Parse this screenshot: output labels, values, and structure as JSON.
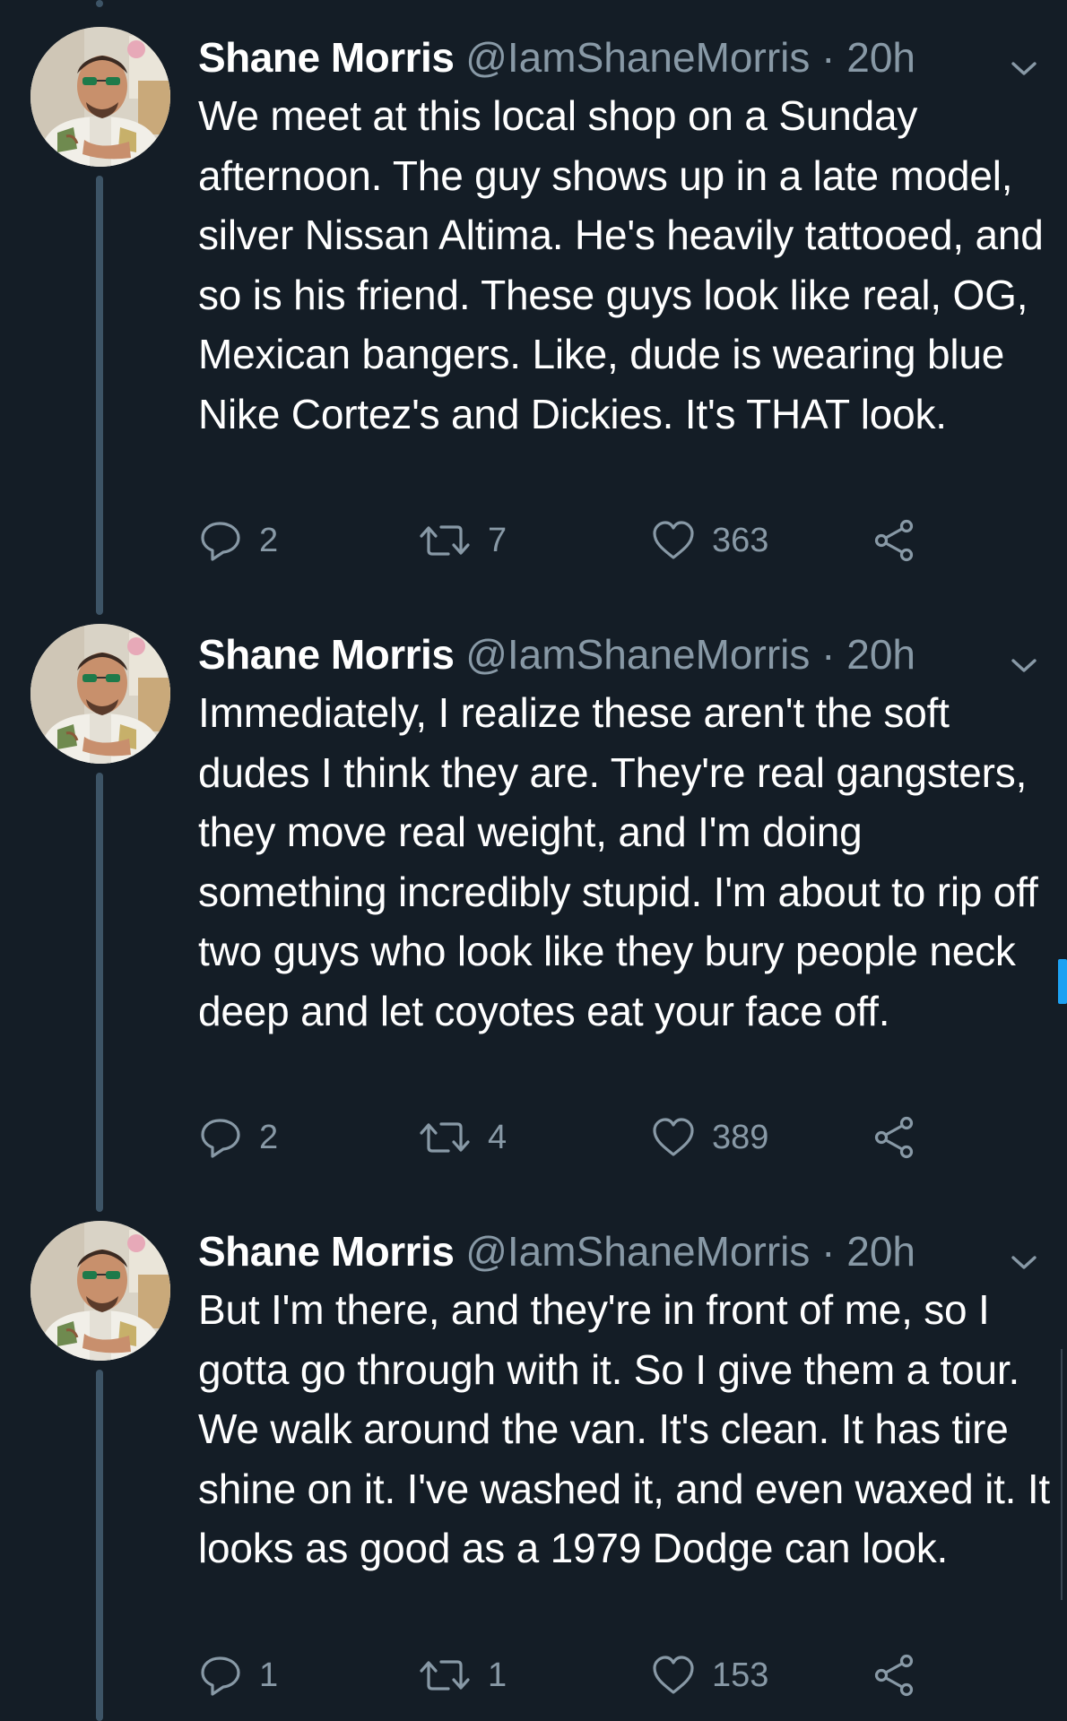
{
  "theme": {
    "background": "#141d26",
    "text_primary": "#ffffff",
    "text_secondary": "#8899a6",
    "thread_line": "#3d5466",
    "accent": "#1da1f2"
  },
  "tweets": [
    {
      "author": {
        "name": "Shane Morris",
        "handle": "@IamShaneMorris",
        "avatar": "profile-photo"
      },
      "separator": "·",
      "time": "20h",
      "text": "We meet at this local shop on a Sunday afternoon. The guy shows up in a late model, silver Nissan Altima. He's heavily tattooed, and so is his friend. These guys look like real, OG, Mexican bangers. Like, dude is wearing blue Nike Cortez's and Dickies. It's THAT look.",
      "actions": {
        "replies": "2",
        "retweets": "7",
        "likes": "363"
      }
    },
    {
      "author": {
        "name": "Shane Morris",
        "handle": "@IamShaneMorris",
        "avatar": "profile-photo"
      },
      "separator": "·",
      "time": "20h",
      "text": "Immediately, I realize these aren't the soft dudes I think they are. They're real gangsters, they move real weight, and I'm doing something incredibly stupid. I'm about to rip off two guys who look like they bury people neck deep and let coyotes eat your face off.",
      "actions": {
        "replies": "2",
        "retweets": "4",
        "likes": "389"
      }
    },
    {
      "author": {
        "name": "Shane Morris",
        "handle": "@IamShaneMorris",
        "avatar": "profile-photo"
      },
      "separator": "·",
      "time": "20h",
      "text": "But I'm there, and they're in front of me, so I gotta go through with it. So I give them a tour. We walk around the van. It's clean. It has tire shine on it. I've washed it, and even waxed it. It looks as good as a 1979 Dodge can look.",
      "actions": {
        "replies": "1",
        "retweets": "1",
        "likes": "153"
      }
    }
  ],
  "icons": {
    "reply": "reply-icon",
    "retweet": "retweet-icon",
    "like": "heart-icon",
    "share": "share-icon",
    "menu": "chevron-down-icon"
  }
}
